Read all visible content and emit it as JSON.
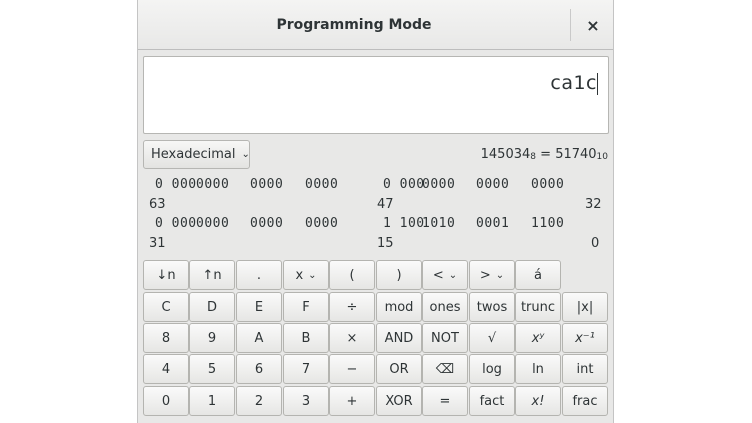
{
  "window": {
    "title": "Programming Mode",
    "close_label": "×"
  },
  "display": {
    "text": "ca1c"
  },
  "base_select": {
    "value": "Hexadecimal",
    "chevron": "⌄"
  },
  "conversion": {
    "left_value": "145034",
    "left_base": "8",
    "equals": "=",
    "right_value": "51740",
    "right_base": "10"
  },
  "bits": {
    "row1_groups": [
      "0 000",
      "0000",
      "0000",
      "0000",
      "0 000",
      "0000",
      "0000",
      "0000"
    ],
    "row1_labels": [
      "63",
      "47",
      "32"
    ],
    "row2_groups": [
      "0 000",
      "0000",
      "0000",
      "0000",
      "1 100",
      "1010",
      "0001",
      "1100"
    ],
    "row2_labels": [
      "31",
      "15",
      "0"
    ]
  },
  "keypad": {
    "row1": [
      "↓n",
      "↑n",
      ".",
      "x",
      "(",
      ")",
      "<",
      ">",
      "á"
    ],
    "row2": [
      "C",
      "D",
      "E",
      "F",
      "÷",
      "mod",
      "ones",
      "twos",
      "trunc",
      "|x|"
    ],
    "row3": [
      "8",
      "9",
      "A",
      "B",
      "×",
      "AND",
      "NOT",
      "√",
      "xʸ",
      "x⁻¹"
    ],
    "row4": [
      "4",
      "5",
      "6",
      "7",
      "−",
      "OR",
      "⌫",
      "log",
      "ln",
      "int"
    ],
    "row5": [
      "0",
      "1",
      "2",
      "3",
      "+",
      "XOR",
      "=",
      "fact",
      "x!",
      "frac"
    ]
  }
}
